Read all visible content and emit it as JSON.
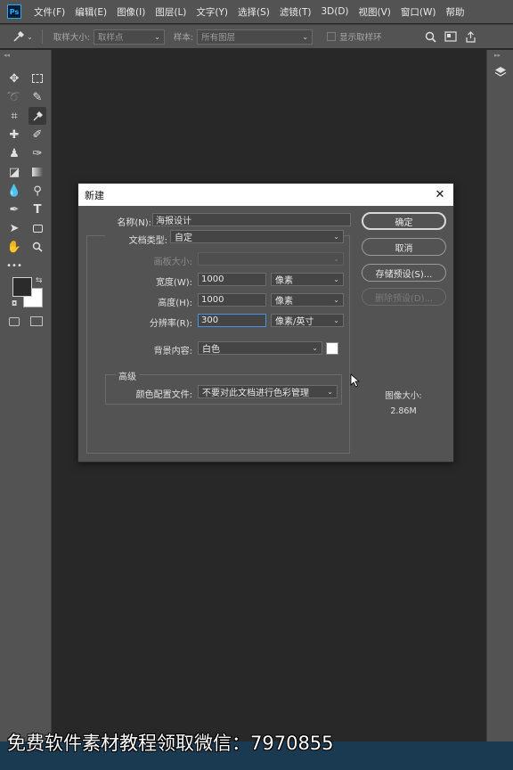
{
  "app": {
    "logo": "Ps"
  },
  "menu": [
    "文件(F)",
    "编辑(E)",
    "图像(I)",
    "图层(L)",
    "文字(Y)",
    "选择(S)",
    "滤镜(T)",
    "3D(D)",
    "视图(V)",
    "窗口(W)",
    "帮助"
  ],
  "options_bar": {
    "tool_icon": "eyedropper-icon",
    "sample_size_label": "取样大小:",
    "sample_size_value": "取样点",
    "sample_label": "样本:",
    "sample_value": "所有图层",
    "show_ring_label": "显示取样环"
  },
  "dialog": {
    "title": "新建",
    "name_label": "名称(N):",
    "name_value": "海报设计",
    "doc_type_label": "文档类型:",
    "doc_type_value": "自定",
    "artboard_size_label": "画板大小:",
    "width_label": "宽度(W):",
    "width_value": "1000",
    "width_unit": "像素",
    "height_label": "高度(H):",
    "height_value": "1000",
    "height_unit": "像素",
    "resolution_label": "分辨率(R):",
    "resolution_value": "300",
    "resolution_unit": "像素/英寸",
    "background_label": "背景内容:",
    "background_value": "白色",
    "background_color": "#ffffff",
    "advanced_label": "高级",
    "color_profile_label": "颜色配置文件:",
    "color_profile_value": "不要对此文档进行色彩管理",
    "image_size_label": "图像大小:",
    "image_size_value": "2.86M",
    "buttons": {
      "ok": "确定",
      "cancel": "取消",
      "save_preset": "存储预设(S)...",
      "delete_preset": "删除预设(D)..."
    }
  },
  "watermark": "免费软件素材教程领取微信：7970855",
  "colors": {
    "ui_panel": "#535353",
    "canvas_bg": "#282828",
    "foreground": "#2b2b2b",
    "background": "#ffffff"
  }
}
